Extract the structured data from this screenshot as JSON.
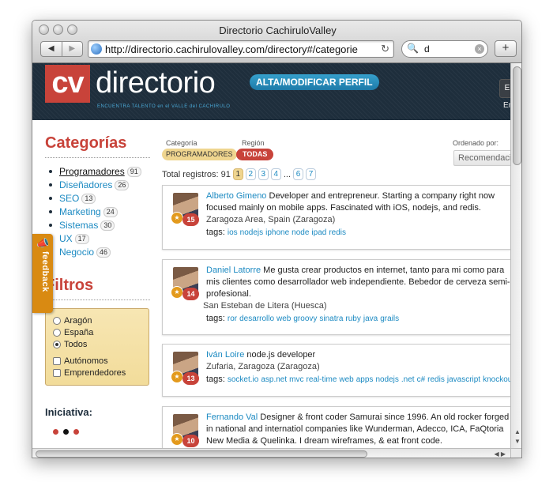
{
  "window": {
    "title": "Directorio CachiruloValley",
    "url": "http://directorio.cachirulovalley.com/directory#/categorie",
    "search_value": "d",
    "back_glyph": "◀",
    "forward_glyph": "▶",
    "reload_glyph": "↻",
    "add_glyph": "+",
    "search_glyph": "🔍",
    "clear_glyph": "×"
  },
  "header": {
    "logo_cv": "cv",
    "logo_word": "directorio",
    "tagline": "ENCUENTRA TALENTO en el VALLE del CACHIRULO",
    "profile_button": "ALTA/MODIFICAR PERFIL",
    "right_button": "E",
    "right_text": "En"
  },
  "sidebar": {
    "categories_title": "Categorías",
    "categories": [
      {
        "label": "Programadores",
        "count": "91",
        "active": true
      },
      {
        "label": "Diseñadores",
        "count": "26",
        "active": false
      },
      {
        "label": "SEO",
        "count": "13",
        "active": false
      },
      {
        "label": "Marketing",
        "count": "24",
        "active": false
      },
      {
        "label": "Sistemas",
        "count": "30",
        "active": false
      },
      {
        "label": "UX",
        "count": "17",
        "active": false
      },
      {
        "label": "Negocio",
        "count": "46",
        "active": false
      }
    ],
    "filters_title": "Filtros",
    "region_options": [
      {
        "label": "Aragón",
        "checked": false
      },
      {
        "label": "España",
        "checked": false
      },
      {
        "label": "Todos",
        "checked": true
      }
    ],
    "type_options": [
      {
        "label": "Autónomos",
        "checked": false
      },
      {
        "label": "Emprendedores",
        "checked": false
      }
    ],
    "initiative_title": "Iniciativa:"
  },
  "feedback": {
    "label": "feedback",
    "icon": "📣"
  },
  "filters_bar": {
    "category_label": "Categoría",
    "category_value": "PROGRAMADORES",
    "region_label": "Región",
    "region_value": "TODAS",
    "sort_label": "Ordenado por:",
    "sort_value": "Recomendaciones"
  },
  "results": {
    "total_text": "Total registros: 91",
    "pages": [
      "1",
      "2",
      "3",
      "4",
      "6",
      "7"
    ],
    "current_page": "1",
    "ellipsis": "..."
  },
  "profiles": [
    {
      "name": "Alberto Gimeno",
      "description": "Developer and entrepreneur. Starting a company right now focused mainly on mobile apps. Fascinated with iOS, nodejs, and redis.",
      "location": "Zaragoza Area, Spain (Zaragoza)",
      "tags_label": "tags:",
      "tags": [
        "ios",
        "nodejs",
        "iphone",
        "node",
        "ipad",
        "redis"
      ],
      "recommendations": "15"
    },
    {
      "name": "Daniel Latorre",
      "description": "Me gusta crear productos en internet, tanto para mi como para mis clientes como desarrollador web independiente. Bebedor de cerveza semi-profesional.",
      "location": "San Esteban de Litera (Huesca)",
      "tags_label": "tags:",
      "tags": [
        "ror",
        "desarrollo",
        "web",
        "groovy",
        "sinatra",
        "ruby",
        "java",
        "grails"
      ],
      "recommendations": "14"
    },
    {
      "name": "Iván Loire",
      "description": "node.js developer",
      "location": "Zufaria, Zaragoza (Zaragoza)",
      "tags_label": "tags:",
      "tags": [
        "socket.io",
        "asp.net",
        "mvc",
        "real-time",
        "web",
        "apps",
        "nodejs",
        ".net",
        "c#",
        "redis",
        "javascript",
        "knockout.js"
      ],
      "recommendations": "13"
    },
    {
      "name": "Fernando Val",
      "description": "Designer & front coder Samurai since 1996. An old rocker forged in national and internatiol companies like Wunderman, Adecco, ICA, FaQtoria New Media & Quelinka. I dream wireframes, & eat front code.",
      "location": "",
      "tags_label": "",
      "tags": [],
      "recommendations": "10"
    }
  ],
  "colors": {
    "accent_red": "#c8433a",
    "link_blue": "#1c8ac2",
    "header_bg": "#1e2e3c",
    "feedback_orange": "#d98a12"
  }
}
